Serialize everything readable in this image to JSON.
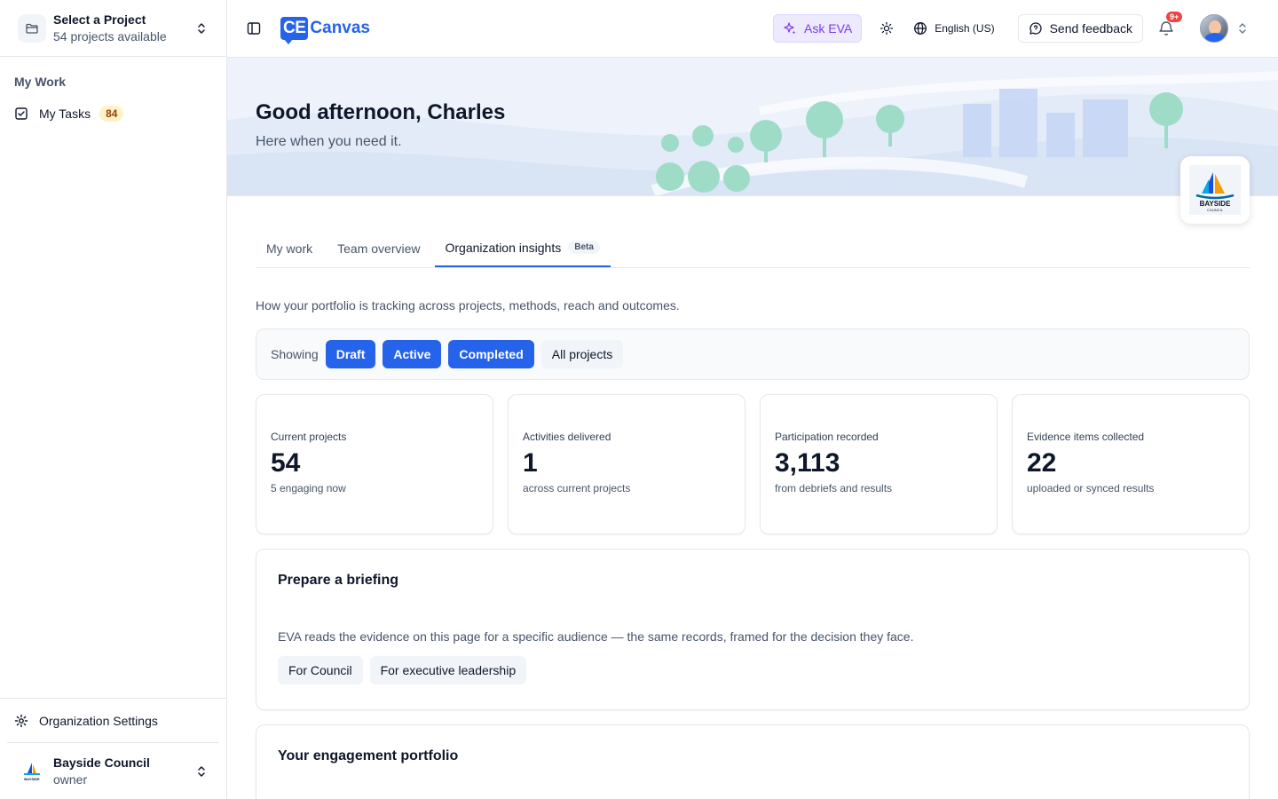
{
  "sidebar": {
    "project_select": {
      "title": "Select a Project",
      "subtitle": "54 projects available"
    },
    "section_heading": "My Work",
    "items": [
      {
        "label": "My Tasks",
        "count": "84"
      }
    ],
    "org_settings_label": "Organization Settings",
    "org": {
      "name": "Bayside Council",
      "role": "owner",
      "logo_text": "BAYSIDE"
    }
  },
  "topbar": {
    "brand_mark": "CE",
    "brand_name": "Canvas",
    "ask_eva_label": "Ask EVA",
    "language_label": "English (US)",
    "feedback_label": "Send feedback",
    "notification_badge": "9+"
  },
  "hero": {
    "greeting": "Good afternoon, Charles",
    "subtitle": "Here when you need it.",
    "org_badge_text": "BAYSIDE",
    "org_badge_sub": "COUNCIL"
  },
  "tabs": [
    {
      "label": "My work"
    },
    {
      "label": "Team overview"
    },
    {
      "label": "Organization insights",
      "badge": "Beta"
    }
  ],
  "insights": {
    "intro": "How your portfolio is tracking across projects, methods, reach and outcomes.",
    "filter": {
      "label": "Showing",
      "chips": [
        "Draft",
        "Active",
        "Completed",
        "All projects"
      ]
    },
    "stats": [
      {
        "label": "Current projects",
        "value": "54",
        "sub": "5 engaging now"
      },
      {
        "label": "Activities delivered",
        "value": "1",
        "sub": "across current projects"
      },
      {
        "label": "Participation recorded",
        "value": "3,113",
        "sub": "from debriefs and results"
      },
      {
        "label": "Evidence items collected",
        "value": "22",
        "sub": "uploaded or synced results"
      }
    ],
    "briefing": {
      "title": "Prepare a briefing",
      "description": "EVA reads the evidence on this page for a specific audience — the same records, framed for the decision they face.",
      "buttons": [
        "For Council",
        "For executive leadership"
      ]
    },
    "portfolio_title": "Your engagement portfolio"
  },
  "colors": {
    "accent": "#2563eb",
    "eva": "#7c3aed",
    "badge_red": "#ef4444"
  }
}
